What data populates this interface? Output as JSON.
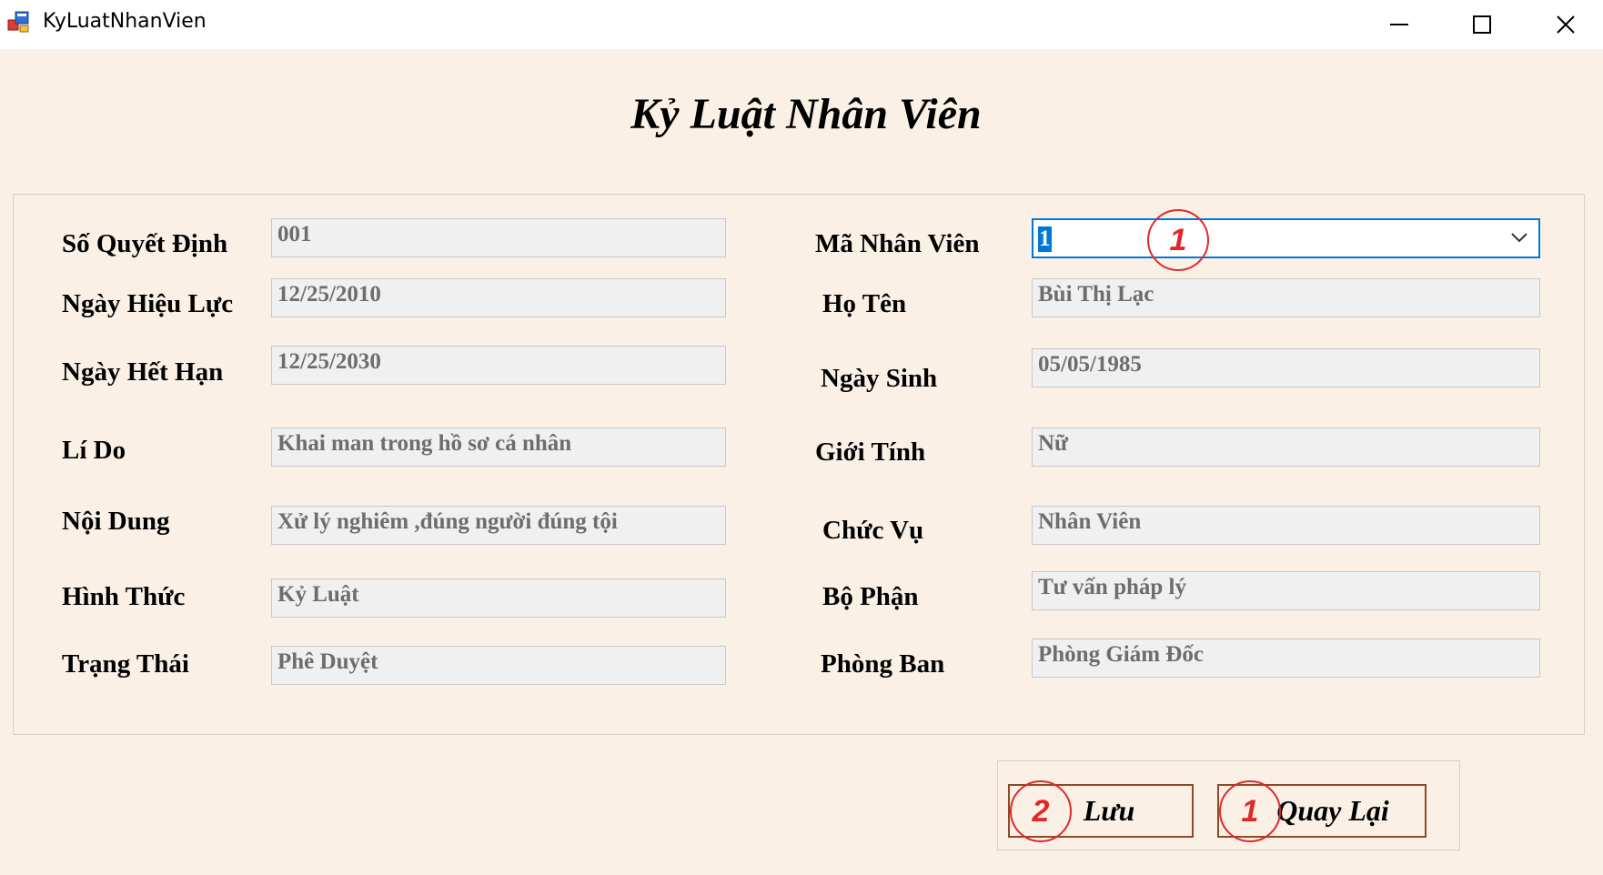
{
  "window": {
    "title": "KyLuatNhanVien",
    "icon": "winforms-app-icon"
  },
  "form": {
    "title": "Kỷ Luật Nhân Viên"
  },
  "left_fields": [
    {
      "label": "Số Quyết Định",
      "value": "001"
    },
    {
      "label": "Ngày Hiệu Lực",
      "value": "12/25/2010"
    },
    {
      "label": "Ngày Hết Hạn",
      "value": "12/25/2030"
    },
    {
      "label": "Lí Do",
      "value": "Khai man trong hồ sơ cá nhân"
    },
    {
      "label": "Nội Dung",
      "value": "Xử lý nghiêm ,đúng người đúng tội"
    },
    {
      "label": "Hình Thức",
      "value": "Kỷ Luật"
    },
    {
      "label": "Trạng Thái",
      "value": "Phê Duyệt"
    }
  ],
  "employee": {
    "label": "Mã Nhân Viên",
    "selected": "1"
  },
  "right_fields": [
    {
      "label": "Họ Tên",
      "value": "Bùi Thị Lạc"
    },
    {
      "label": "Ngày Sinh",
      "value": "05/05/1985"
    },
    {
      "label": "Giới Tính",
      "value": "Nữ"
    },
    {
      "label": "Chức Vụ",
      "value": "Nhân Viên"
    },
    {
      "label": "Bộ Phận",
      "value": "Tư vấn pháp lý"
    },
    {
      "label": "Phòng Ban",
      "value": "Phòng Giám Đốc"
    }
  ],
  "buttons": {
    "save": "Lưu",
    "back": "Quay Lại"
  },
  "markers": {
    "combo": "1",
    "save": "2",
    "back": "1"
  },
  "colors": {
    "background": "#faf0e6",
    "marker": "#e0282a",
    "focus": "#0078d7",
    "button_border": "#8c4a28"
  }
}
